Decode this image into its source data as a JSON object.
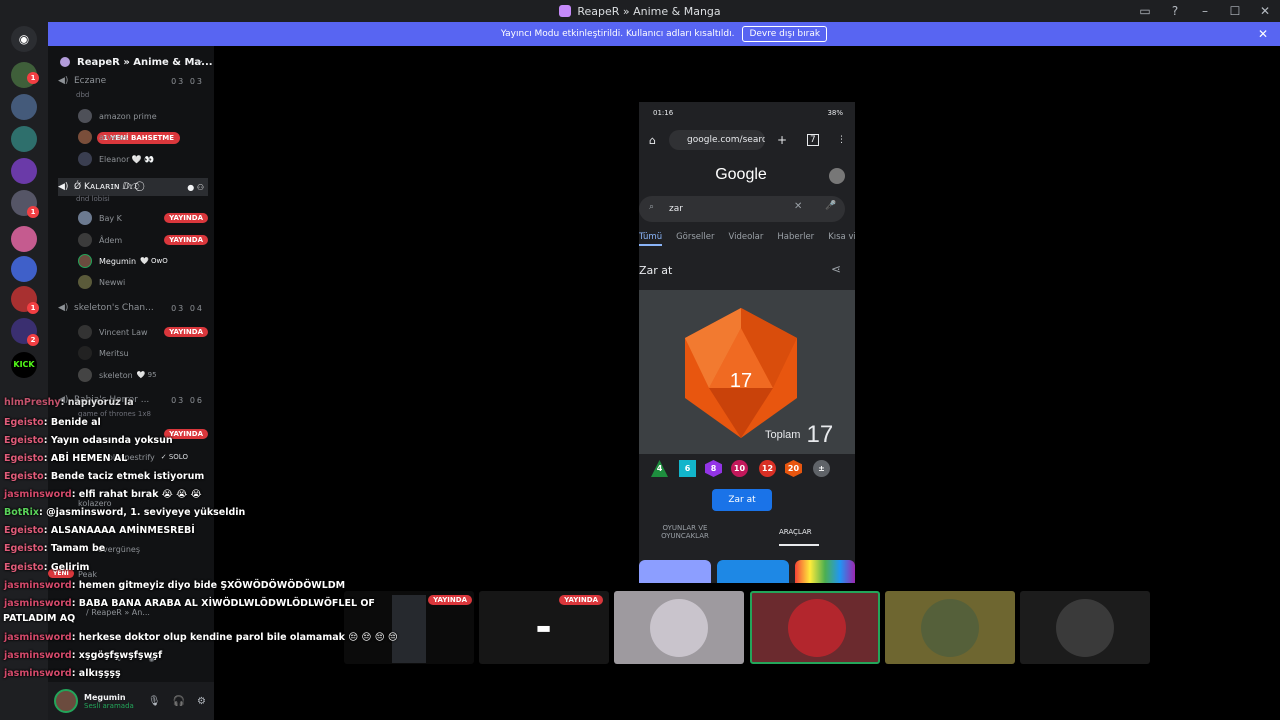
{
  "window": {
    "title": "ReapeR » Anime & Manga"
  },
  "streamer_banner": {
    "text": "Yayıncı Modu etkinleştirildi. Kullanıcı adları kısaltıldı.",
    "button": "Devre dışı bırak"
  },
  "server": {
    "name": "ReapeR » Anime & Ma...",
    "chevron": "chevron-down-icon"
  },
  "new_mention": "1 YENİ BAHSETME",
  "channels": [
    {
      "name": "Eczane",
      "sub": "dbd",
      "count": "03 03",
      "users": [
        "amazon prime",
        "arveles",
        "Eleanor 🤍 👀"
      ]
    },
    {
      "name": "Ǿ Kᴀʟᴀʀɪɴ ⅅ𝔯𝔇 ⃝",
      "sub": "dnd lobisi",
      "users": [
        {
          "name": "Bay K",
          "live": "YAYINDA"
        },
        {
          "name": "Âdem",
          "live": "YAYINDA"
        },
        {
          "name": "Megumin",
          "tag": "🤍 OwO"
        },
        {
          "name": "Newwi"
        }
      ]
    },
    {
      "name": "skeleton's Chan...",
      "count": "03 04",
      "users": [
        {
          "name": "Vincent Law",
          "live": "YAYINDA"
        },
        {
          "name": "Meritsu"
        },
        {
          "name": "skeleton",
          "tag": "🤍 95"
        }
      ]
    },
    {
      "name": "Rabia's Horror ...",
      "sub": "game of thrones 1x8",
      "count": "03 06",
      "live": "YAYINDA",
      "solo": "✓ SOLO",
      "user": "olkapestrify",
      "u2": "kolazero",
      "u3": "overgüneş",
      "u4": "Peak",
      "yeni": "YENİ",
      "u5": "/ ReapeR » An..."
    }
  ],
  "user_panel": {
    "name": "Megumin",
    "status": "Sesli aramada"
  },
  "chat": [
    {
      "user": "hlmPreshy",
      "msg": ": napıyoruz la"
    },
    {
      "user": "Egeisto",
      "msg": ": Benide al"
    },
    {
      "user": "Egeisto",
      "msg": ": Yayın odasında yoksun"
    },
    {
      "user": "Egeisto",
      "msg": ": ABİ HEMEN AL"
    },
    {
      "user": "Egeisto",
      "msg": ": Bende taciz etmek istiyorum"
    },
    {
      "user": "jasminsword",
      "msg": ": elfi rahat bırak 😭 😭 😭"
    },
    {
      "user": "BotRix",
      "msg": ": @jasminsword, 1. seviyeye yükseldin"
    },
    {
      "user": "Egeisto",
      "msg": ": ALSANAAAA AMİNMESREBİ"
    },
    {
      "user": "Egeisto",
      "msg": ": Tamam be"
    },
    {
      "user": "Egeisto",
      "msg": ": Gelirim"
    },
    {
      "user": "jasminsword",
      "msg": ": hemen gitmeyiz diyo bide ŞXÖWÖDÖWÖDÖWLDM"
    },
    {
      "user": "jasminsword",
      "msg": ": BABA BANA ARABA AL XİWÖDLWLÖDWLÖDLWÖFLEL OF"
    },
    {
      "user": "",
      "msg": "PATLADIM AQ"
    },
    {
      "user": "jasminsword",
      "msg": ": herkese doktor olup kendine parol bile olamamak 😔 😔 😔 😔"
    },
    {
      "user": "jasminsword",
      "msg": ": xşgöşfşwşfşwşf"
    },
    {
      "user": "jasminsword",
      "msg": ": alkışşşş"
    }
  ],
  "phone": {
    "time": "01:16",
    "battery": "38%",
    "url": "google.com/searc",
    "logo": "Google",
    "query": "zar",
    "tabs": [
      "Tümü",
      "Görseller",
      "Videolar",
      "Haberler",
      "Kısa vi"
    ],
    "heading": "Zar at",
    "die_value": "17",
    "total_label": "Toplam",
    "total_value": "17",
    "dice": [
      "4",
      "6",
      "8",
      "10",
      "12",
      "20",
      "±"
    ],
    "roll_button": "Zar at",
    "bottom_tab1": "OYUNLAR VE OYUNCAKLAR",
    "bottom_tab2": "ARAÇLAR"
  },
  "tiles": {
    "live1": "YAYINDA",
    "live2": "YAYINDA"
  },
  "colors": {
    "accent": "#5865f2",
    "live": "#da373c",
    "die": "#e8560f"
  }
}
